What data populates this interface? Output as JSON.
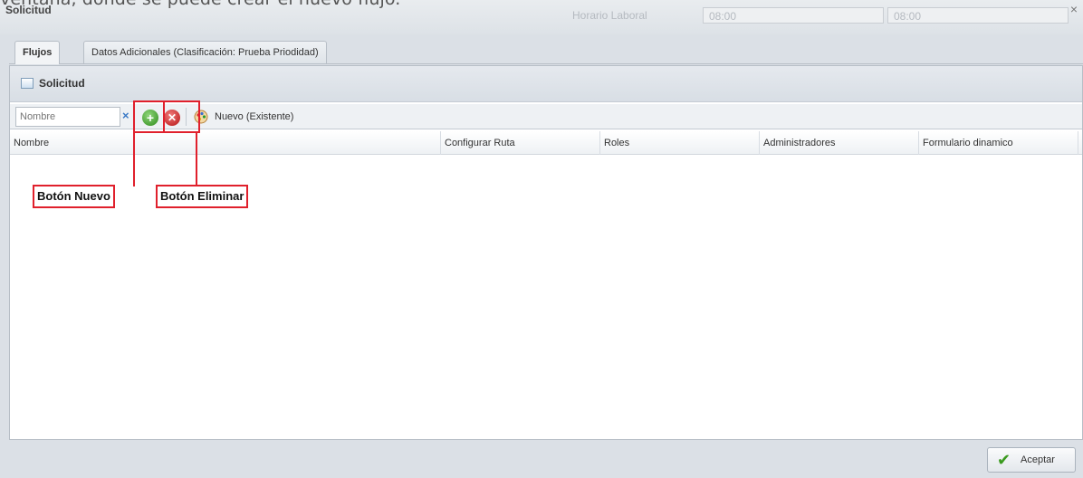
{
  "caption": "ventana, donde se puede crear el nuevo flujo.",
  "window": {
    "title": "Solicitud",
    "ghost_label": "Horario Laboral",
    "ghost_time_1": "08:00",
    "ghost_time_2": "08:00",
    "close_icon": "close-icon"
  },
  "tabs": [
    {
      "label": "Flujos",
      "active": true
    },
    {
      "label": "Datos Adicionales (Clasificación: Prueba Priodidad)",
      "active": false
    }
  ],
  "panel": {
    "title": "Solicitud",
    "icon": "document-icon"
  },
  "toolbar": {
    "search_placeholder": "Nombre",
    "clear_icon": "clear-x-icon",
    "add_icon": "add-circle-icon",
    "delete_icon": "delete-circle-icon",
    "existing_icon": "palette-icon",
    "existing_label": "Nuevo (Existente)"
  },
  "grid": {
    "columns": [
      "Nombre",
      "Configurar Ruta",
      "Roles",
      "Administradores",
      "Formulario dinamico"
    ]
  },
  "footer": {
    "accept_label": "Aceptar",
    "accept_icon": "checkmark-icon"
  },
  "annotations": {
    "new_button": "Botón Nuevo",
    "delete_button": "Botón Eliminar",
    "color": "#e0202c"
  }
}
